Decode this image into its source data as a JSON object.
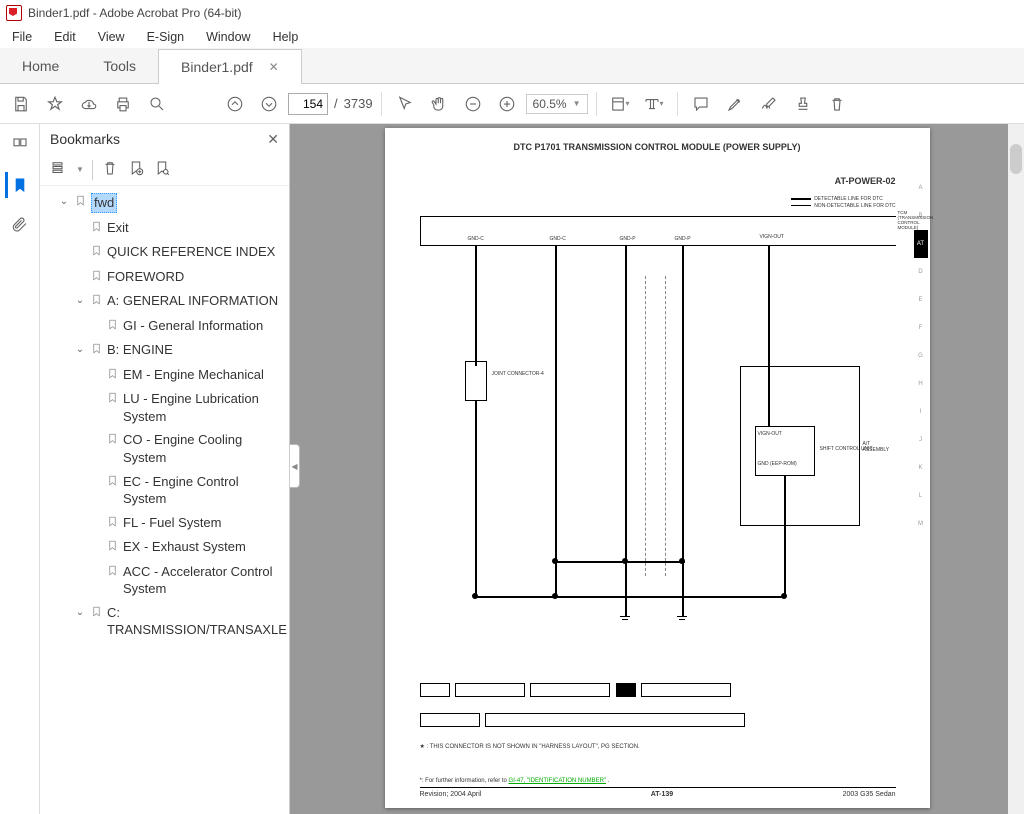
{
  "window": {
    "title": "Binder1.pdf - Adobe Acrobat Pro (64-bit)"
  },
  "menu": {
    "items": [
      "File",
      "Edit",
      "View",
      "E-Sign",
      "Window",
      "Help"
    ]
  },
  "tabs": {
    "home": "Home",
    "tools": "Tools",
    "doc": "Binder1.pdf"
  },
  "toolbar": {
    "page_current": "154",
    "page_total": "3739",
    "page_sep": "/",
    "zoom": "60.5%"
  },
  "bookmarks": {
    "title": "Bookmarks",
    "items": [
      {
        "label": "fwd",
        "level": 1,
        "expand": "open",
        "selected": true
      },
      {
        "label": "Exit",
        "level": 2,
        "expand": "none"
      },
      {
        "label": "QUICK REFERENCE INDEX",
        "level": 2,
        "expand": "none"
      },
      {
        "label": "FOREWORD",
        "level": 2,
        "expand": "none"
      },
      {
        "label": "A: GENERAL INFORMATION",
        "level": 2,
        "expand": "open"
      },
      {
        "label": "GI - General Information",
        "level": 3,
        "expand": "none"
      },
      {
        "label": "B: ENGINE",
        "level": 2,
        "expand": "open"
      },
      {
        "label": "EM - Engine Mechanical",
        "level": 3,
        "expand": "none"
      },
      {
        "label": "LU - Engine Lubrication System",
        "level": 3,
        "expand": "none"
      },
      {
        "label": "CO - Engine Cooling System",
        "level": 3,
        "expand": "none"
      },
      {
        "label": "EC - Engine Control System",
        "level": 3,
        "expand": "none"
      },
      {
        "label": "FL - Fuel System",
        "level": 3,
        "expand": "none"
      },
      {
        "label": "EX - Exhaust System",
        "level": 3,
        "expand": "none"
      },
      {
        "label": "ACC - Accelerator Control System",
        "level": 3,
        "expand": "none"
      },
      {
        "label": "C: TRANSMISSION/TRANSAXLE",
        "level": 2,
        "expand": "open"
      }
    ]
  },
  "doc": {
    "title": "DTC P1701 TRANSMISSION CONTROL MODULE (POWER SUPPLY)",
    "subtitle": "AT-POWER-02",
    "legend1": "DETECTABLE LINE FOR DTC",
    "legend2": "NON-DETECTABLE LINE FOR DTC",
    "tcm": "TCM (TRANSMISSION CONTROL MODULE)",
    "pins": {
      "p1": "GND-C",
      "p2": "GND-C",
      "p3": "GND-P",
      "p4": "GND-P",
      "p5": "VIGN-OUT"
    },
    "jc": "JOINT CONNECTOR-4",
    "shift": "SHIFT CONTROL UNIT",
    "shift2": "GND (EEP-ROM)",
    "vign": "VIGN-OUT",
    "assy": "A/T ASSEMBLY",
    "side_tabs": [
      "A",
      "B",
      "AT",
      "D",
      "E",
      "F",
      "G",
      "H",
      "I",
      "J",
      "K",
      "L",
      "M"
    ],
    "note1": "★ : THIS CONNECTOR IS NOT SHOWN IN \"HARNESS LAYOUT\", PG SECTION.",
    "note2_a": "*: For further information, refer to ",
    "note2_b": "GI-47, \"IDENTIFICATION NUMBER\"",
    "note2_c": " .",
    "foot_left": "Revision; 2004 April",
    "foot_center": "AT-139",
    "foot_right": "2003 G35 Sedan"
  }
}
